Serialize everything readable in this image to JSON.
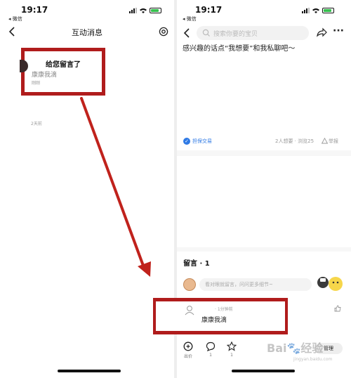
{
  "left": {
    "status": {
      "time": "19:17",
      "back_app": "◂ 微信"
    },
    "nav": {
      "title": "互动消息"
    },
    "message": {
      "title": "给您留言了",
      "user": "康康我滴",
      "time": "刚刚"
    },
    "earlier_time": "2天前"
  },
  "right": {
    "status": {
      "time": "19:17",
      "back_app": "◂ 微信"
    },
    "search": {
      "placeholder": "搜索你要的宝贝"
    },
    "post": {
      "text": "感兴趣的话点“我想要”和我私聊吧～"
    },
    "meta": {
      "guarantee": "担保交易",
      "stats": "2人想要 · 浏览25",
      "report": "举报"
    },
    "comments": {
      "title": "留言 · 1",
      "input_placeholder": "看对眼就留言，问问更多细节~",
      "items": [
        {
          "time": "· 1分钟前",
          "text": "康康我滴"
        }
      ]
    },
    "toolbar": {
      "bid": "出价",
      "comment_count": "1",
      "fav_count": "1",
      "manage": "管理"
    }
  },
  "watermark": {
    "logo": "Bai🐾经验",
    "sub": "jingyan.baidu.com"
  },
  "colors": {
    "highlight": "#b01c1c",
    "arrow": "#c0221c",
    "accent_blue": "#2f7ae5"
  }
}
